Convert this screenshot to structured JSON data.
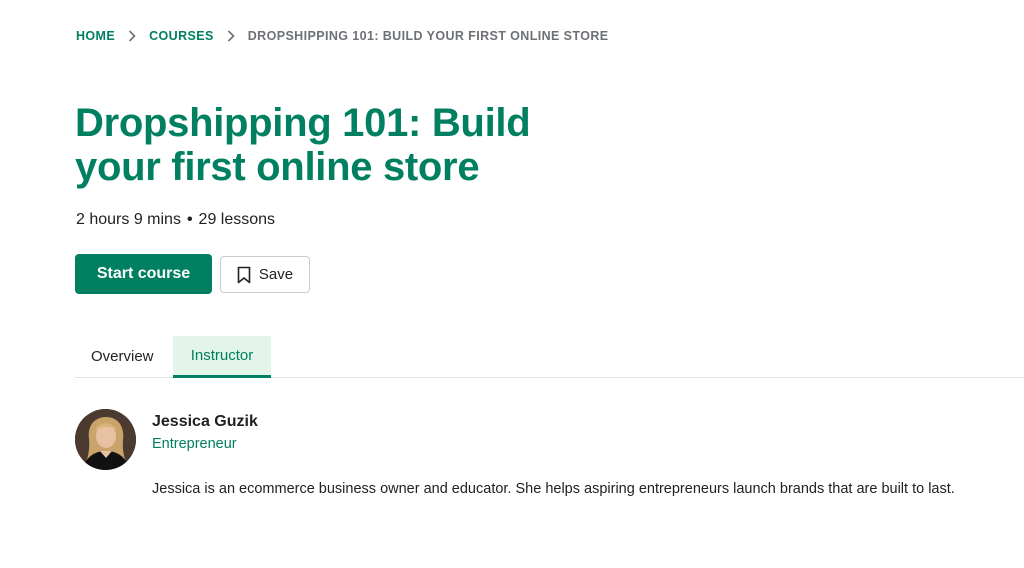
{
  "breadcrumb": {
    "home": "HOME",
    "courses": "COURSES",
    "current": "DROPSHIPPING 101: BUILD YOUR FIRST ONLINE STORE",
    "separator_icon": "chevron-right-icon"
  },
  "course": {
    "title_line1": "Dropshipping 101: Build",
    "title_line2": "your first online store",
    "duration": "2 hours 9 mins",
    "separator": "•",
    "lessons": "29 lessons"
  },
  "actions": {
    "start_label": "Start course",
    "save_label": "Save",
    "save_icon": "bookmark-icon"
  },
  "tabs": [
    {
      "label": "Overview",
      "active": false
    },
    {
      "label": "Instructor",
      "active": true
    }
  ],
  "instructor": {
    "name": "Jessica Guzik",
    "role": "Entrepreneur",
    "bio": "Jessica is an ecommerce business owner and educator. She helps aspiring entrepreneurs launch brands that are built to last."
  },
  "colors": {
    "brand_green": "#008060",
    "active_tab_bg": "#e3f5ea",
    "muted_text": "#6d7175"
  }
}
